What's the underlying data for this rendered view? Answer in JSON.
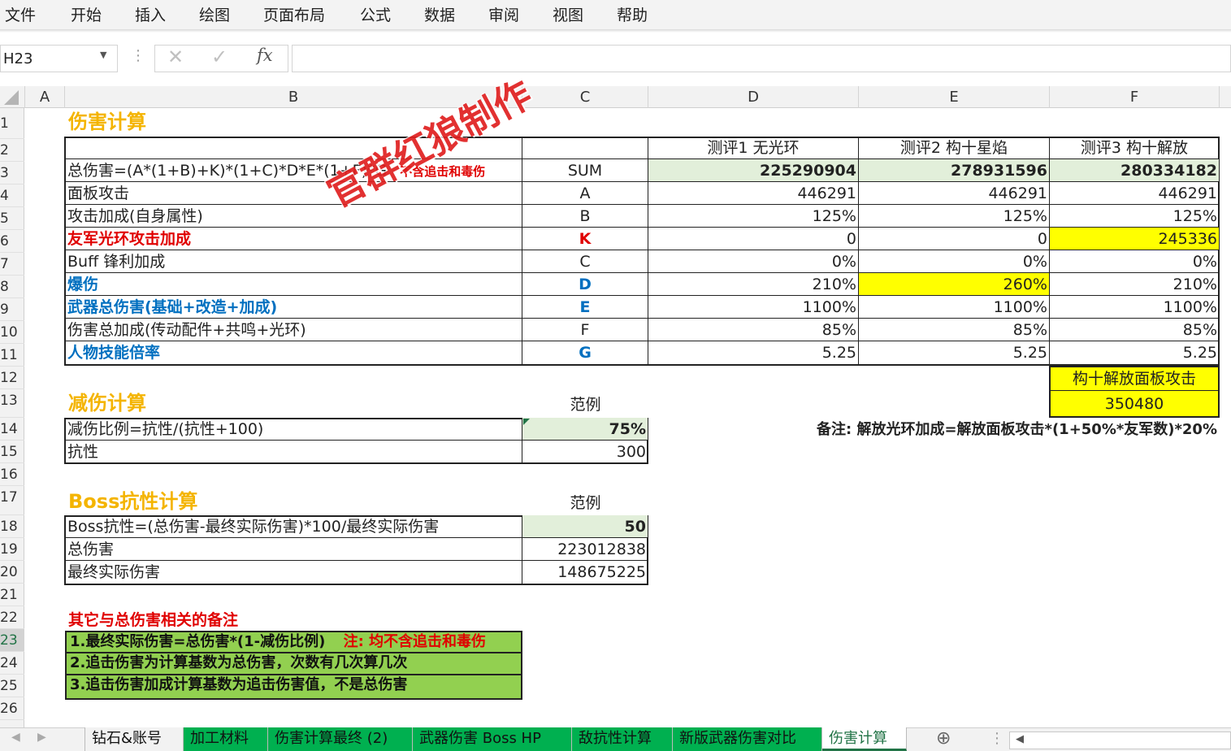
{
  "menu": [
    "文件",
    "开始",
    "插入",
    "绘图",
    "页面布局",
    "公式",
    "数据",
    "审阅",
    "视图",
    "帮助"
  ],
  "namebox": "H23",
  "formula_icons": {
    "cancel": "✕",
    "enter": "✓",
    "fx": "fx"
  },
  "columns": [
    "A",
    "B",
    "C",
    "D",
    "E",
    "F"
  ],
  "rows": [
    "1",
    "2",
    "3",
    "4",
    "5",
    "6",
    "7",
    "8",
    "9",
    "10",
    "11",
    "12",
    "13",
    "14",
    "15",
    "16",
    "17",
    "18",
    "19",
    "20",
    "21",
    "22",
    "23",
    "24",
    "25",
    "26"
  ],
  "sec1": {
    "title": "伤害计算",
    "headers": [
      "测评1 无光环",
      "测评2 构十星焰",
      "测评3 构十解放"
    ],
    "formula": "总伤害=(A*(1+B)+K)*(1+C)*D*E*(1+F)*G",
    "formula_note": "不含追击和毒伤",
    "sum_label": "SUM",
    "sums": [
      "225290904",
      "278931596",
      "280334182"
    ],
    "items": [
      {
        "label": "面板攻击",
        "code": "A",
        "vals": [
          "446291",
          "446291",
          "446291"
        ]
      },
      {
        "label": "攻击加成(自身属性)",
        "code": "B",
        "vals": [
          "125%",
          "125%",
          "125%"
        ]
      },
      {
        "label": "友军光环攻击加成",
        "code": "K",
        "vals": [
          "0",
          "0",
          "245336"
        ]
      },
      {
        "label": "Buff 锋利加成",
        "code": "C",
        "vals": [
          "0%",
          "0%",
          "0%"
        ]
      },
      {
        "label": "爆伤",
        "code": "D",
        "vals": [
          "210%",
          "260%",
          "210%"
        ]
      },
      {
        "label": "武器总伤害(基础+改造+加成)",
        "code": "E",
        "vals": [
          "1100%",
          "1100%",
          "1100%"
        ]
      },
      {
        "label": "伤害总加成(传动配件+共鸣+光环)",
        "code": "F",
        "vals": [
          "85%",
          "85%",
          "85%"
        ]
      },
      {
        "label": "人物技能倍率",
        "code": "G",
        "vals": [
          "5.25",
          "5.25",
          "5.25"
        ]
      }
    ],
    "box_label": "构十解放面板攻击",
    "box_value": "350480",
    "remark": "备注: 解放光环加成=解放面板攻击*(1+50%*友军数)*20%"
  },
  "sec2": {
    "title": "减伤计算",
    "example": "范例",
    "row1_label": "减伤比例=抗性/(抗性+100)",
    "row1_val": "75%",
    "row2_label": "抗性",
    "row2_val": "300"
  },
  "sec3": {
    "title": "Boss抗性计算",
    "example": "范例",
    "row1_label": "Boss抗性=(总伤害-最终实际伤害)*100/最终实际伤害",
    "row1_val": "50",
    "row2_label": "总伤害",
    "row2_val": "223012838",
    "row3_label": "最终实际伤害",
    "row3_val": "148675225"
  },
  "notes": {
    "title": "其它与总伤害相关的备注",
    "n1": "1.最终实际伤害=总伤害*(1-减伤比例)",
    "n1_note": "注: 均不含追击和毒伤",
    "n2": "2.追击伤害为计算基数为总伤害，次数有几次算几次",
    "n3": "3.追击伤害加成计算基数为追击伤害值，不是总伤害"
  },
  "watermark": "官群红狼制作",
  "tabs": [
    "钻石&账号",
    "加工材料",
    "伤害计算最终 (2)",
    "武器伤害 Boss HP",
    "敌抗性计算",
    "新版武器伤害对比",
    "伤害计算"
  ],
  "add_sheet_icon": "⊕"
}
